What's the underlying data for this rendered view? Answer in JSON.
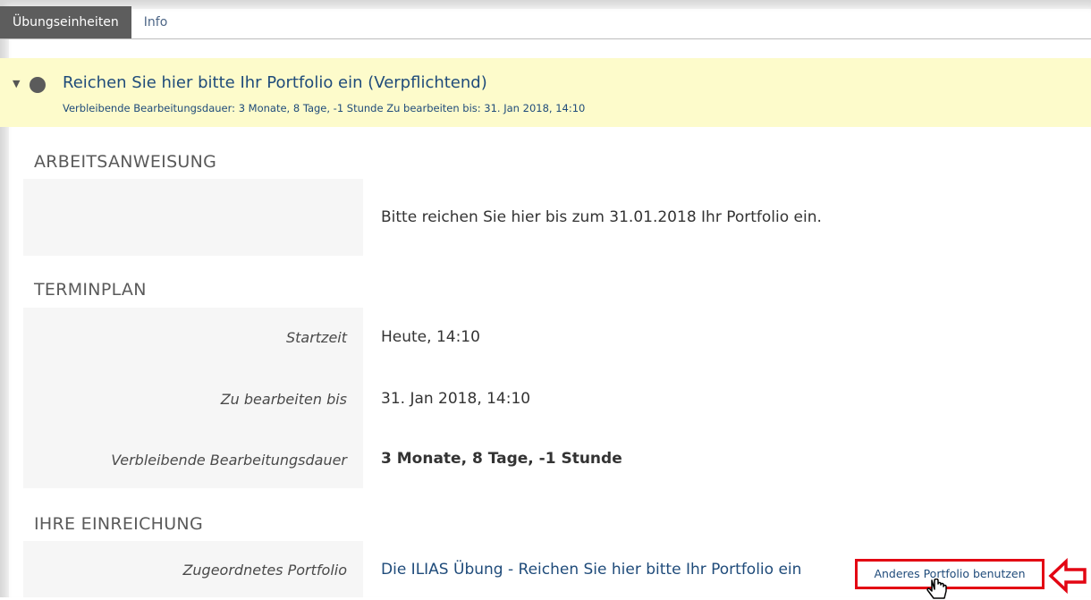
{
  "tabs": [
    {
      "label": "Übungseinheiten",
      "active": true
    },
    {
      "label": "Info",
      "active": false
    }
  ],
  "assignment": {
    "title": "Reichen Sie hier bitte Ihr Portfolio ein (Verpflichtend)",
    "subtitle": "Verbleibende Bearbeitungsdauer: 3 Monate, 8 Tage, -1 Stunde  Zu bearbeiten bis: 31. Jan 2018, 14:10"
  },
  "instructions": {
    "heading": "ARBEITSANWEISUNG",
    "text": "Bitte reichen Sie hier bis zum 31.01.2018 Ihr Portfolio ein."
  },
  "schedule": {
    "heading": "TERMINPLAN",
    "rows": [
      {
        "label": "Startzeit",
        "value": "Heute, 14:10"
      },
      {
        "label": "Zu bearbeiten bis",
        "value": "31. Jan 2018, 14:10"
      },
      {
        "label": "Verbleibende Bearbeitungsdauer",
        "value": "3 Monate, 8 Tage, -1 Stunde"
      }
    ]
  },
  "submission": {
    "heading": "IHRE EINREICHUNG",
    "label": "Zugeordnetes Portfolio",
    "portfolio_link": "Die ILIAS Übung - Reichen Sie hier bitte Ihr Portfolio ein",
    "change_button": "Anderes Portfolio benutzen"
  },
  "colors": {
    "accent": "#1f4b7a",
    "highlight": "#fdfbcb",
    "annotation": "#e30613"
  }
}
